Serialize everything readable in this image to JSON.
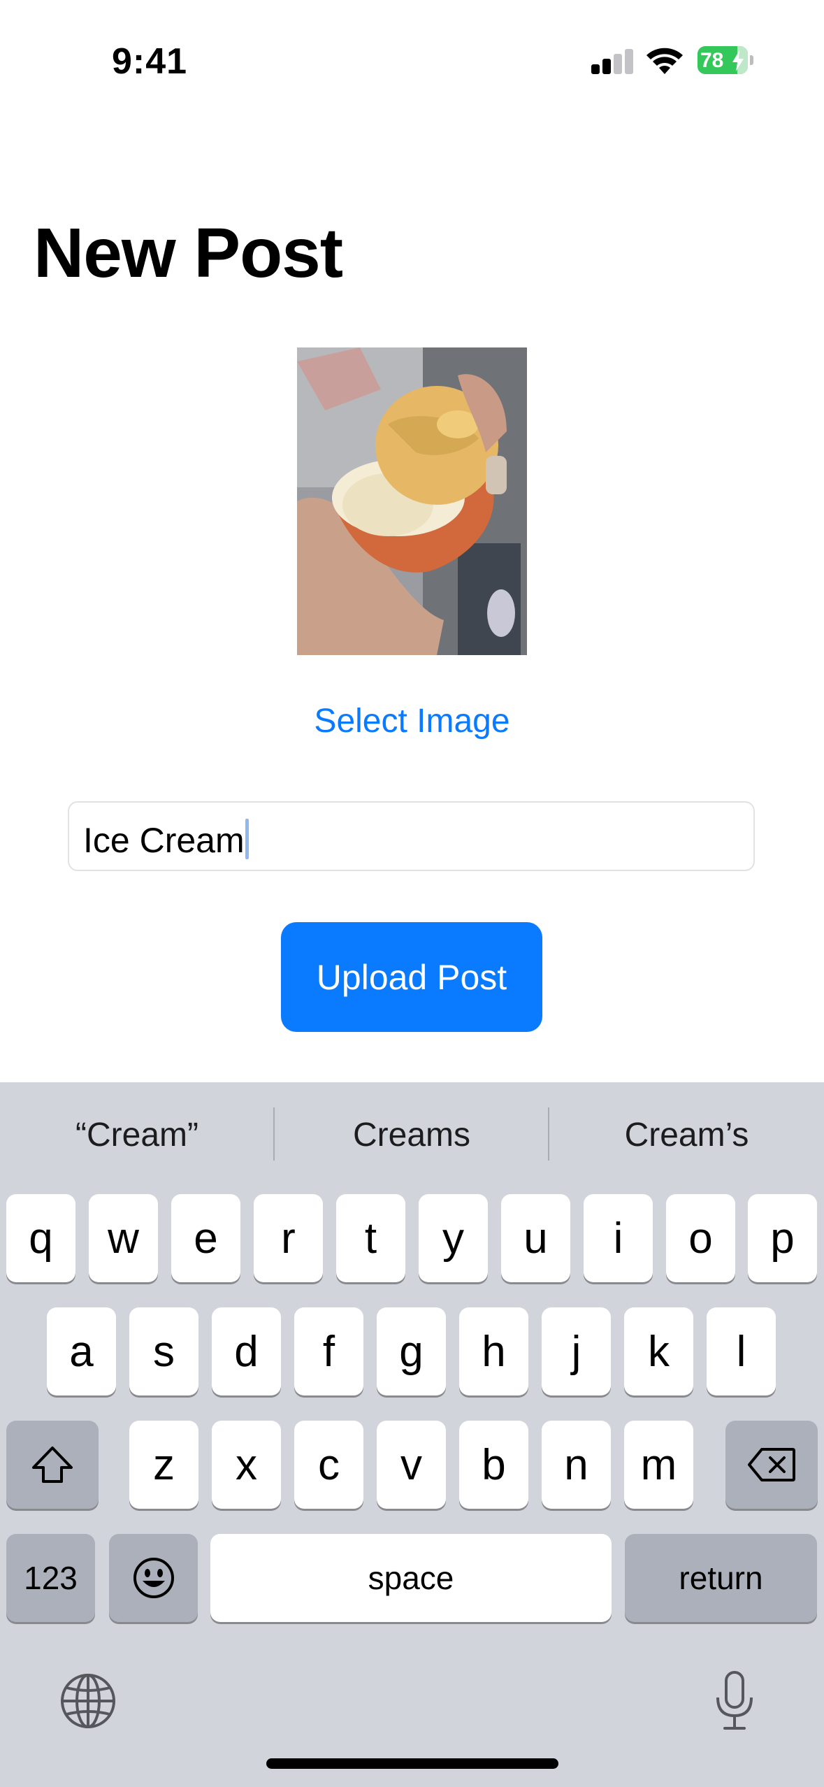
{
  "status_bar": {
    "time": "9:41",
    "battery_level": "78",
    "battery_color": "#34c759"
  },
  "header": {
    "title": "New Post"
  },
  "image_picker": {
    "select_label": "Select Image",
    "photo_alt": "ice cream cup photo"
  },
  "caption": {
    "value": "Ice Cream"
  },
  "upload_button": {
    "label": "Upload Post",
    "color": "#0a7aff"
  },
  "keyboard": {
    "suggestions": [
      "“Cream”",
      "Creams",
      "Cream’s"
    ],
    "row1": [
      "q",
      "w",
      "e",
      "r",
      "t",
      "y",
      "u",
      "i",
      "o",
      "p"
    ],
    "row2": [
      "a",
      "s",
      "d",
      "f",
      "g",
      "h",
      "j",
      "k",
      "l"
    ],
    "row3": [
      "z",
      "x",
      "c",
      "v",
      "b",
      "n",
      "m"
    ],
    "numbers_label": "123",
    "space_label": "space",
    "return_label": "return",
    "icons": [
      "shift-icon",
      "delete-icon",
      "emoji-icon",
      "globe-icon",
      "microphone-icon"
    ]
  }
}
